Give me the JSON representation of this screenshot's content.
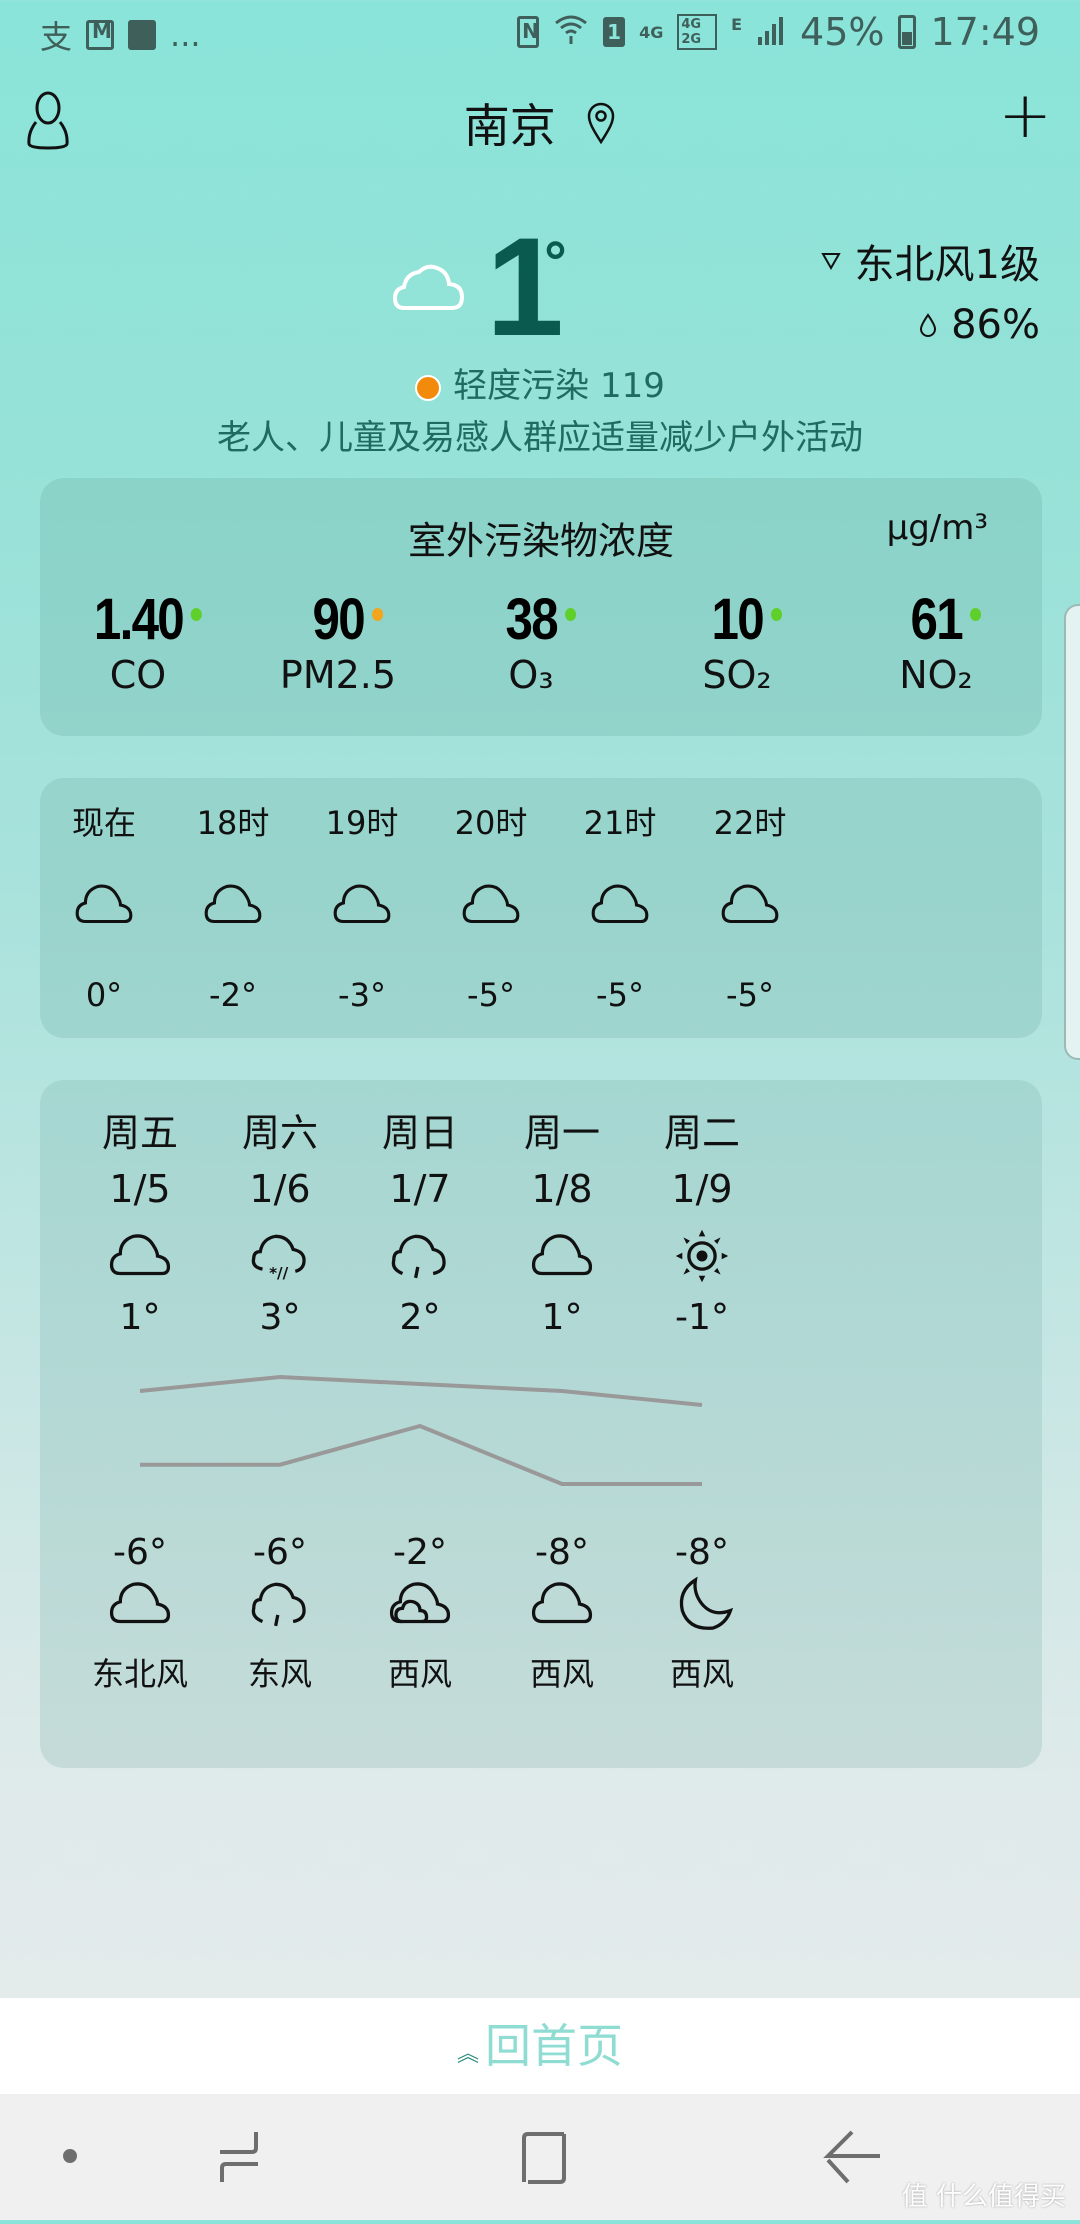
{
  "status_bar": {
    "left_icons": [
      "alipay-icon",
      "gmail-icon",
      "gallery-icon"
    ],
    "more": "...",
    "network_4g": "4G",
    "network_4g_2g": [
      "4G",
      "2G"
    ],
    "network_e": "E",
    "sim": "1",
    "battery_percent": "45%",
    "time": "17:49"
  },
  "header": {
    "city": "南京",
    "add_label": "+"
  },
  "current": {
    "temperature": "1",
    "degree_symbol": "°",
    "condition_icon": "cloud-icon",
    "wind": "东北风1级",
    "humidity": "86%",
    "aqi_label": "轻度污染 119",
    "aqi_color": "#f28b0c",
    "advice": "老人、儿童及易感人群应适量减少户外活动"
  },
  "pollutants": {
    "title": "室外污染物浓度",
    "unit": "μg/m³",
    "items": [
      {
        "value": "1.40",
        "name": "CO",
        "color": "#5fcf2c"
      },
      {
        "value": "90",
        "name": "PM2.5",
        "color": "#f2a51d"
      },
      {
        "value": "38",
        "name": "O₃",
        "color": "#5fcf2c"
      },
      {
        "value": "10",
        "name": "SO₂",
        "color": "#5fcf2c"
      },
      {
        "value": "61",
        "name": "NO₂",
        "color": "#5fcf2c"
      }
    ]
  },
  "hourly": [
    {
      "time": "现在",
      "icon": "cloud-icon",
      "temp": "0°"
    },
    {
      "time": "18时",
      "icon": "cloud-icon",
      "temp": "-2°"
    },
    {
      "time": "19时",
      "icon": "cloud-icon",
      "temp": "-3°"
    },
    {
      "time": "20时",
      "icon": "cloud-icon",
      "temp": "-5°"
    },
    {
      "time": "21时",
      "icon": "cloud-icon",
      "temp": "-5°"
    },
    {
      "time": "22时",
      "icon": "cloud-icon",
      "temp": "-5°"
    }
  ],
  "daily": [
    {
      "day": "周五",
      "date": "1/5",
      "day_icon": "cloud-icon",
      "high": "1°",
      "low": "-6°",
      "night_icon": "cloud-icon",
      "wind": "东北风"
    },
    {
      "day": "周六",
      "date": "1/6",
      "day_icon": "sleet-icon",
      "high": "3°",
      "low": "-6°",
      "night_icon": "light-rain-icon",
      "wind": "东风"
    },
    {
      "day": "周日",
      "date": "1/7",
      "day_icon": "light-rain-icon",
      "high": "2°",
      "low": "-2°",
      "night_icon": "overcast-icon",
      "wind": "西风"
    },
    {
      "day": "周一",
      "date": "1/8",
      "day_icon": "cloud-icon",
      "high": "1°",
      "low": "-8°",
      "night_icon": "cloud-icon",
      "wind": "西风"
    },
    {
      "day": "周二",
      "date": "1/9",
      "day_icon": "sun-icon",
      "high": "-1°",
      "low": "-8°",
      "night_icon": "moon-icon",
      "wind": "西风"
    }
  ],
  "chart_data": {
    "type": "line",
    "x": [
      "1/5",
      "1/6",
      "1/7",
      "1/8",
      "1/9"
    ],
    "series": [
      {
        "name": "high",
        "values": [
          1,
          3,
          2,
          1,
          -1
        ]
      },
      {
        "name": "low",
        "values": [
          -6,
          -6,
          -2,
          -8,
          -8
        ]
      }
    ],
    "color": "#999999"
  },
  "bottom": {
    "home_label": "回首页",
    "watermark": "值 什么值得买"
  }
}
